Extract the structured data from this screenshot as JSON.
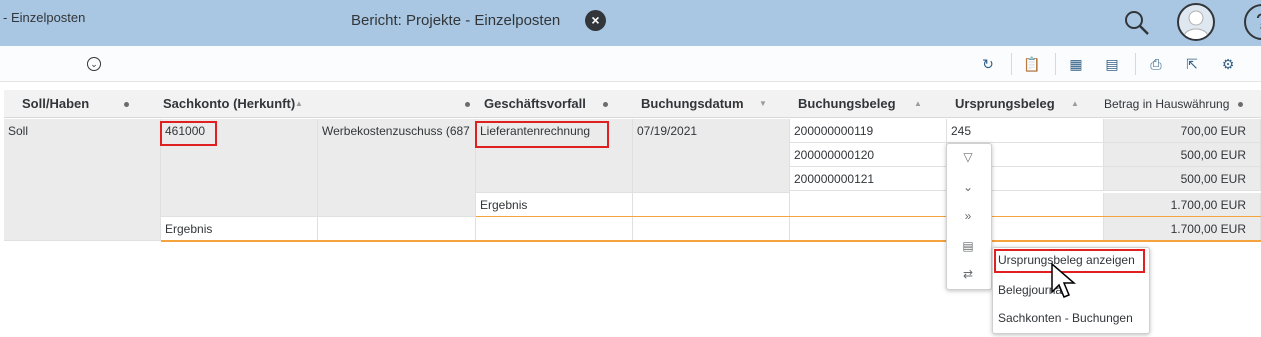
{
  "shell": {
    "title": "Bericht: Projekte - Einzelposten",
    "close_glyph": "×",
    "help_glyph": "?",
    "icons": [
      "close-icon",
      "search-icon",
      "avatar",
      "help-icon"
    ]
  },
  "subheader": {
    "title": "- Einzelposten",
    "variant_glyph": "⌄",
    "toolbar_icons": [
      "refresh-icon",
      "clipboard-icon",
      "table-icon",
      "table-settings-icon",
      "print-icon",
      "export-icon",
      "settings-icon"
    ],
    "toolbar_glyphs": [
      "↻",
      "📋",
      "▦",
      "▤",
      "⎙",
      "⇱",
      "⚙"
    ]
  },
  "table": {
    "headers": [
      "Soll/Haben",
      "Sachkonto (Herkunft)",
      "Geschäftsvorfall",
      "Buchungsdatum",
      "Buchungsbeleg",
      "Ursprungsbeleg",
      "Betrag in Hauswährung"
    ],
    "rows": {
      "soll_haben": "Soll",
      "sachkonto": "461000",
      "sachkonto_text": "Werbekostenzuschuss (687",
      "geschaeftsvorfall": "Lieferantenrechnung",
      "buchungsdatum": "07/19/2021",
      "belege": [
        "200000000119",
        "200000000120",
        "200000000121"
      ],
      "ursprungsbeleg": "245",
      "betraege": [
        "700,00 EUR",
        "500,00 EUR",
        "500,00 EUR"
      ],
      "subtotal_label": "Ergebnis",
      "subtotal_value": "1.700,00 EUR",
      "total_label": "Ergebnis",
      "total_value": "1.700,00 EUR"
    }
  },
  "context_menu": {
    "icons": [
      "filter-icon",
      "collapse-icon",
      "expand-icon",
      "clipboard-icon",
      "navigate-icon"
    ],
    "glyphs": [
      "▽",
      "⌄",
      "»",
      "▤",
      "⇄"
    ]
  },
  "submenu": {
    "items": [
      "Ursprungsbeleg anzeigen",
      "Belegjournal",
      "Sachkonten - Buchungen"
    ]
  }
}
